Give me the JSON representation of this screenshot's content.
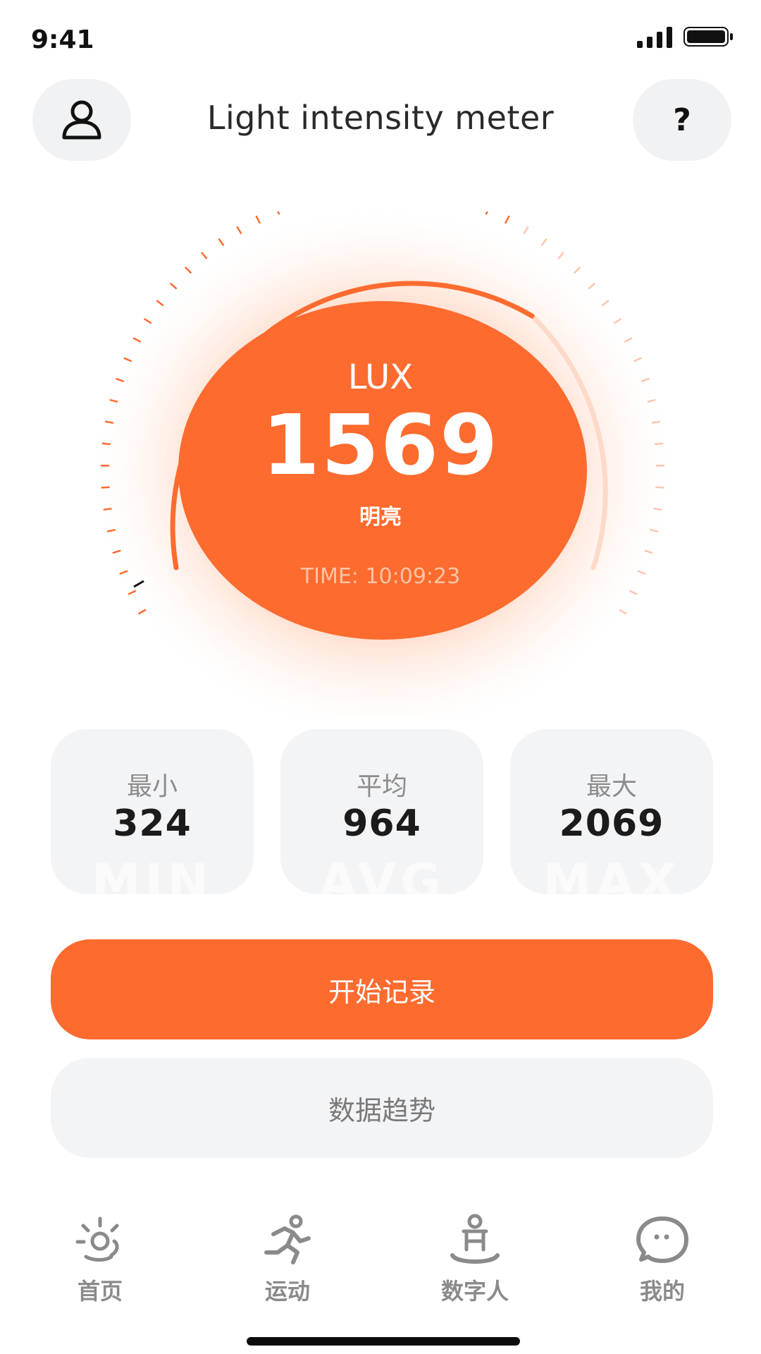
{
  "status_bar": {
    "time": "9:41"
  },
  "header": {
    "title": "Light intensity meter",
    "help_label": "?"
  },
  "gauge": {
    "unit_label": "LUX",
    "value": "1569",
    "level_label": "明亮",
    "time_readout": "TIME: 10:09:23",
    "accent_color": "#fe6b2f"
  },
  "stats": [
    {
      "label": "最小",
      "value": "324",
      "watermark": "MIN"
    },
    {
      "label": "平均",
      "value": "964",
      "watermark": "AVG"
    },
    {
      "label": "最大",
      "value": "2069",
      "watermark": "MAX"
    }
  ],
  "actions": {
    "primary_label": "开始记录",
    "secondary_label": "数据趋势"
  },
  "tab_bar": [
    {
      "label": "首页",
      "icon": "sun-icon"
    },
    {
      "label": "运动",
      "icon": "runner-icon"
    },
    {
      "label": "数字人",
      "icon": "digital-human-icon"
    },
    {
      "label": "我的",
      "icon": "chat-face-icon"
    }
  ]
}
